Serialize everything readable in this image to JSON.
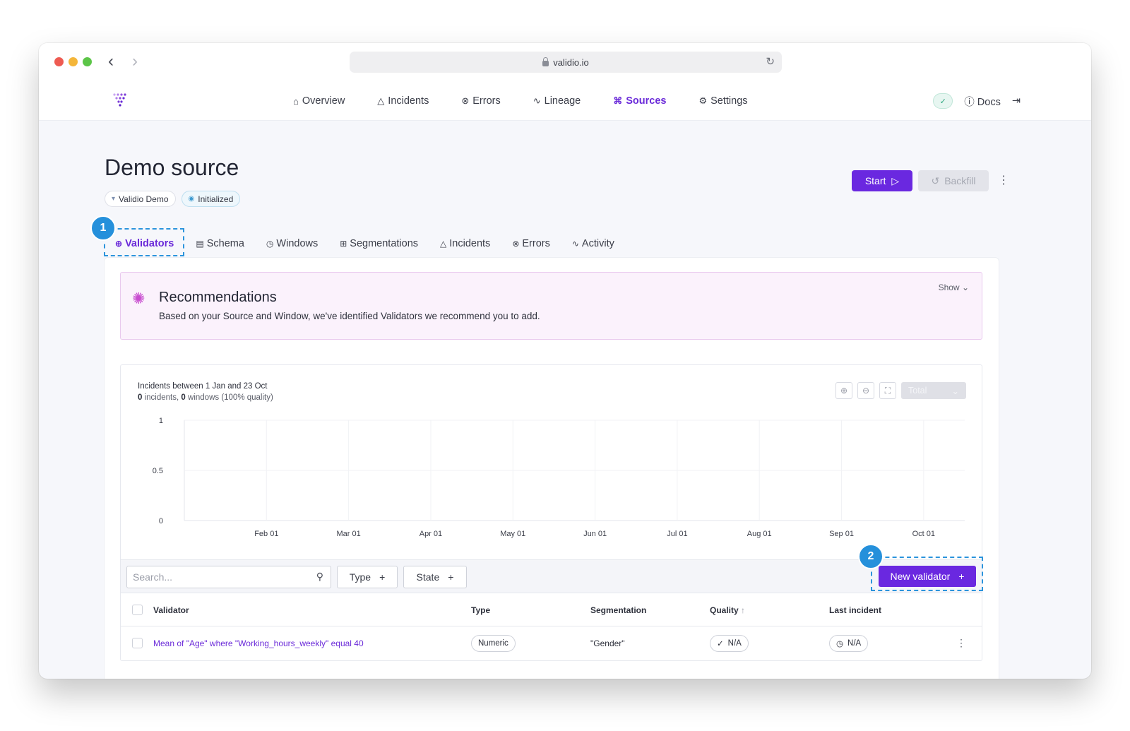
{
  "browser": {
    "url": "validio.io"
  },
  "nav": {
    "items": [
      {
        "label": "Overview",
        "icon": "home-icon",
        "glyph": "⌂"
      },
      {
        "label": "Incidents",
        "icon": "warning-icon",
        "glyph": "△"
      },
      {
        "label": "Errors",
        "icon": "error-circle-icon",
        "glyph": "⊗"
      },
      {
        "label": "Lineage",
        "icon": "lineage-icon",
        "glyph": "∿"
      },
      {
        "label": "Sources",
        "icon": "sources-icon",
        "glyph": "⌘"
      },
      {
        "label": "Settings",
        "icon": "gear-icon",
        "glyph": "⚙"
      }
    ],
    "docs": "Docs"
  },
  "header": {
    "title": "Demo source",
    "chips": [
      "Validio Demo",
      "Initialized"
    ],
    "start_label": "Start",
    "backfill_label": "Backfill"
  },
  "tabs": [
    {
      "label": "Validators",
      "glyph": "⊕"
    },
    {
      "label": "Schema",
      "glyph": "▤"
    },
    {
      "label": "Windows",
      "glyph": "◷"
    },
    {
      "label": "Segmentations",
      "glyph": "⊞"
    },
    {
      "label": "Incidents",
      "glyph": "△"
    },
    {
      "label": "Errors",
      "glyph": "⊗"
    },
    {
      "label": "Activity",
      "glyph": "∿"
    }
  ],
  "callouts": [
    "1",
    "2"
  ],
  "recommendations": {
    "title": "Recommendations",
    "description": "Based on your Source and Window, we've identified Validators we recommend you to add.",
    "show_label": "Show"
  },
  "chart": {
    "heading": "Incidents between 1 Jan and 23 Oct",
    "incidents": "0",
    "incidents_label": "incidents,",
    "windows": "0",
    "windows_label": "windows (100% quality)",
    "select_label": "Total"
  },
  "chart_data": {
    "type": "line",
    "categories": [
      "Feb 01",
      "Mar 01",
      "Apr 01",
      "May 01",
      "Jun 01",
      "Jul 01",
      "Aug 01",
      "Sep 01",
      "Oct 01"
    ],
    "yticks": [
      "1",
      "0.5",
      "0"
    ],
    "series": [],
    "ylim": [
      0,
      1
    ],
    "grid": true
  },
  "toolbar": {
    "search_placeholder": "Search...",
    "type_label": "Type",
    "state_label": "State",
    "new_validator_label": "New validator"
  },
  "table": {
    "headers": [
      "Validator",
      "Type",
      "Segmentation",
      "Quality",
      "Last incident"
    ],
    "rows": [
      {
        "validator": "Mean of \"Age\" where \"Working_hours_weekly\" equal 40",
        "type": "Numeric",
        "segmentation": "\"Gender\"",
        "quality": "N/A",
        "last_incident": "N/A"
      }
    ]
  }
}
